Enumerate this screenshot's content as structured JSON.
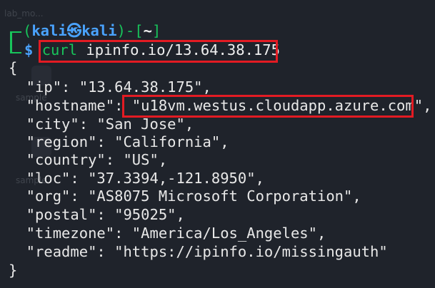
{
  "desktop": {
    "ghost_labels": [
      "lab_mo...",
      "sample",
      "sample"
    ]
  },
  "prompt": {
    "open_paren": "(",
    "user": "kali",
    "at_symbol": "㉿",
    "host": "kali",
    "close_paren_dash": ")-[",
    "cwd": "~",
    "close_bracket": "]",
    "dollar": "$",
    "command": "curl",
    "argument": "ipinfo.io/13.64.38.175"
  },
  "output": {
    "open_brace": "{",
    "lines": [
      "  \"ip\": \"13.64.38.175\",",
      "  \"hostname\": \"u18vm.westus.cloudapp.azure.com\",",
      "  \"city\": \"San Jose\",",
      "  \"region\": \"California\",",
      "  \"country\": \"US\",",
      "  \"loc\": \"37.3394,-121.8950\",",
      "  \"org\": \"AS8075 Microsoft Corporation\",",
      "  \"postal\": \"95025\",",
      "  \"timezone\": \"America/Los_Angeles\",",
      "  \"readme\": \"https://ipinfo.io/missingauth\""
    ],
    "close_brace": "}"
  },
  "colors": {
    "background": "#1f232b",
    "prompt_frame": "#18c45b",
    "user_host": "#4aa3ff",
    "highlight_box": "#e31b23",
    "command": "#f2f24b"
  }
}
